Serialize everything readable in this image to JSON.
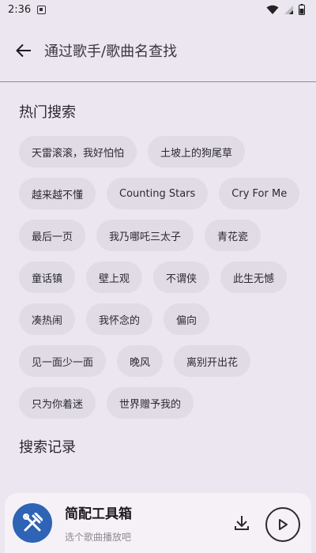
{
  "status_bar": {
    "time": "2:36"
  },
  "header": {
    "title": "通过歌手/歌曲名查找"
  },
  "hot_search": {
    "title": "热门搜索",
    "rows": [
      [
        "天雷滚滚，我好怕怕",
        "土坡上的狗尾草"
      ],
      [
        "越来越不懂",
        "Counting Stars",
        "Cry For Me"
      ],
      [
        "最后一页",
        "我乃哪吒三太子",
        "青花瓷"
      ],
      [
        "童话镇",
        "壁上观",
        "不谓侠",
        "此生无憾"
      ],
      [
        "凑热闹",
        "我怀念的",
        "偏向"
      ],
      [
        "见一面少一面",
        "晚风",
        "离别开出花"
      ],
      [
        "只为你着迷",
        "世界赠予我的"
      ]
    ]
  },
  "history": {
    "title": "搜索记录"
  },
  "player": {
    "name": "简配工具箱",
    "subtitle": "选个歌曲播放吧",
    "cover_color": "#2e63b6"
  }
}
